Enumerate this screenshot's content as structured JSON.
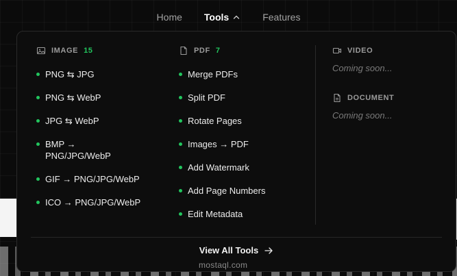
{
  "nav": {
    "items": [
      {
        "label": "Home"
      },
      {
        "label": "Tools"
      },
      {
        "label": "Features"
      }
    ]
  },
  "dropdown": {
    "image": {
      "title": "IMAGE",
      "count": "15",
      "icon": "image-icon",
      "items": [
        {
          "label": "PNG ⇆ JPG"
        },
        {
          "label": "PNG ⇆ WebP"
        },
        {
          "label": "JPG ⇆ WebP"
        },
        {
          "label": "BMP → PNG/JPG/WebP"
        },
        {
          "label": "GIF → PNG/JPG/WebP"
        },
        {
          "label": "ICO → PNG/JPG/WebP"
        }
      ]
    },
    "pdf": {
      "title": "PDF",
      "count": "7",
      "icon": "file-icon",
      "items": [
        {
          "label": "Merge PDFs"
        },
        {
          "label": "Split PDF"
        },
        {
          "label": "Rotate Pages"
        },
        {
          "label": "Images → PDF"
        },
        {
          "label": "Add Watermark"
        },
        {
          "label": "Add Page Numbers"
        },
        {
          "label": "Edit Metadata"
        }
      ]
    },
    "video": {
      "title": "VIDEO",
      "status": "Coming soon...",
      "icon": "video-icon"
    },
    "document": {
      "title": "DOCUMENT",
      "status": "Coming soon...",
      "icon": "document-icon"
    },
    "footer": {
      "label": "View All Tools",
      "icon": "arrow-right-icon"
    }
  },
  "watermark": "mostaql.com",
  "colors": {
    "accent": "#22c55e",
    "background": "#0b0b0b",
    "panel": "#0d0d0d"
  }
}
